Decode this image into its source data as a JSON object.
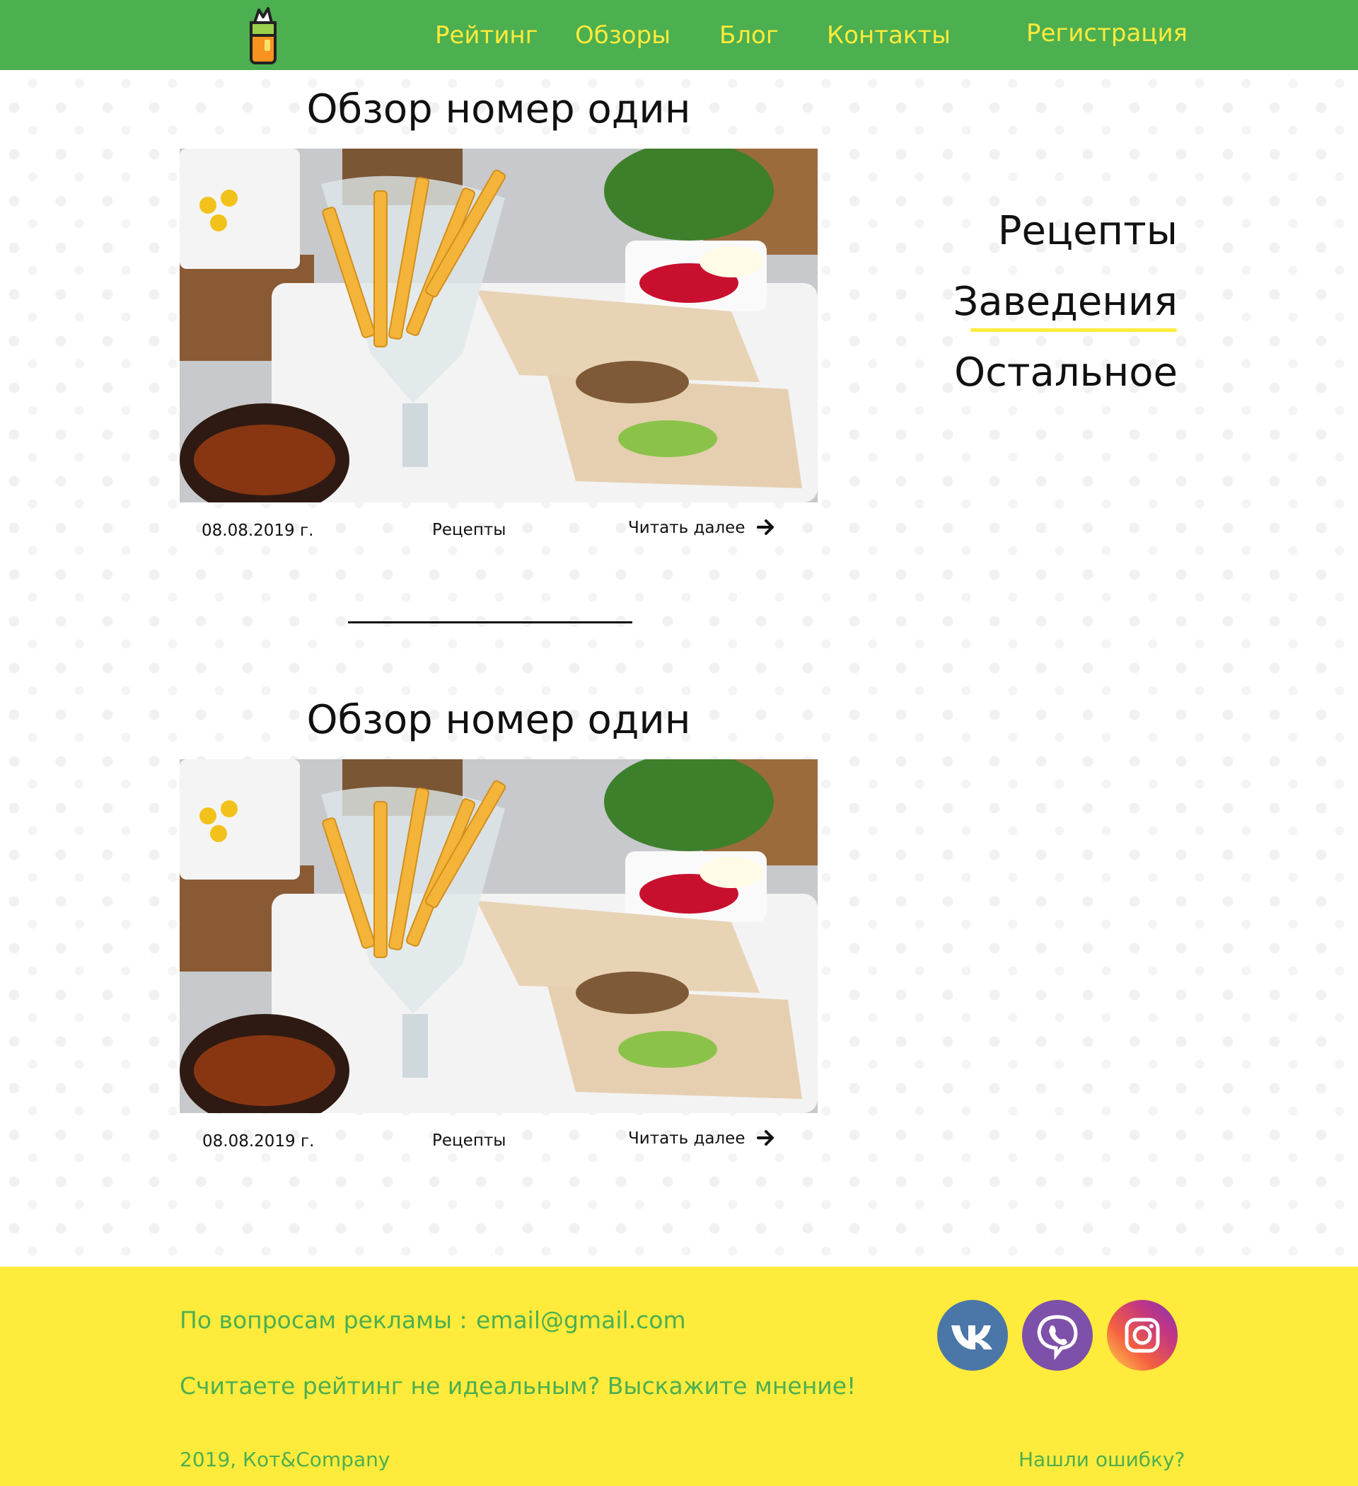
{
  "header": {
    "nav": [
      "Рейтинг",
      "Обзоры",
      "Блог",
      "Контакты"
    ],
    "register_label": "Регистрация"
  },
  "articles": [
    {
      "title": "Обзор номер один",
      "date": "08.08.2019 г.",
      "category": "Рецепты",
      "read_more": "Читать далее"
    },
    {
      "title": "Обзор номер один",
      "date": "08.08.2019 г.",
      "category": "Рецепты",
      "read_more": "Читать далее"
    }
  ],
  "sidebar": {
    "items": [
      "Рецепты",
      "Заведения",
      "Остальное"
    ],
    "active_index": 1
  },
  "footer": {
    "ads_label": "По вопросам рекламы :",
    "email": "email@gmail.com",
    "feedback": "Считаете рейтинг не идеальным? Выскажите мнение!",
    "copyright": "2019, Кот&Company",
    "report_error": "Нашли ошибку?"
  },
  "social": [
    "vk-icon",
    "viber-icon",
    "instagram-icon"
  ],
  "colors": {
    "header_green": "#4caf50",
    "accent_yellow": "#ffeb3b",
    "footer_text": "#4caf50"
  }
}
